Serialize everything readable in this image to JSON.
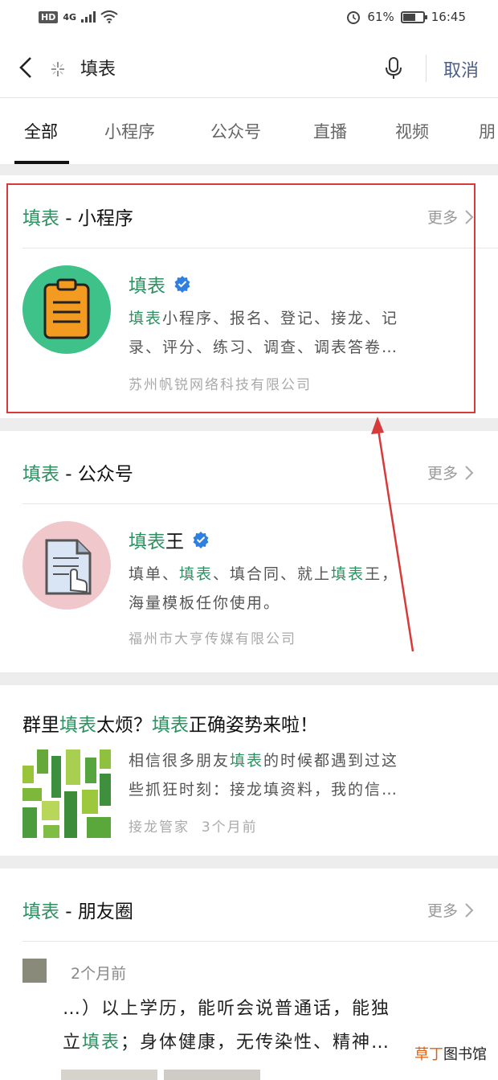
{
  "status_bar": {
    "network_label": "HD",
    "network_type": "4G",
    "battery_percent": "61%",
    "time": "16:45"
  },
  "search": {
    "query": "填表",
    "cancel_label": "取消"
  },
  "tabs": [
    {
      "label": "全部",
      "active": true
    },
    {
      "label": "小程序"
    },
    {
      "label": "公众号"
    },
    {
      "label": "直播"
    },
    {
      "label": "视频"
    },
    {
      "label": "朋"
    }
  ],
  "more_label": "更多",
  "mini_program": {
    "section_keyword": "填表",
    "section_suffix": " - 小程序",
    "name": "填表",
    "desc_line1_hl": "填表",
    "desc_line1_rest": "小程序、报名、登记、接龙、记",
    "desc_line2": "录、评分、练习、调查、调表答卷…",
    "owner": "苏州帆锐网络科技有限公司"
  },
  "official_account": {
    "section_keyword": "填表",
    "section_suffix": " - 公众号",
    "name_hl": "填表",
    "name_rest": "王",
    "desc_line1_a": "填单、",
    "desc_line1_hl1": "填表",
    "desc_line1_b": "、填合同、就上",
    "desc_line1_hl2": "填表",
    "desc_line1_c": "王，",
    "desc_line2": "海量模板任你使用。",
    "owner": "福州市大亨传媒有限公司"
  },
  "article": {
    "title_a": "群里",
    "title_hl1": "填表",
    "title_b": "太烦？",
    "title_hl2": "填表",
    "title_c": "正确姿势来啦！",
    "desc_line1_a": "相信很多朋友",
    "desc_line1_hl": "填表",
    "desc_line1_b": "的时候都遇到过这",
    "desc_line2": "些抓狂时刻：接龙填资料，我的信…",
    "source": "接龙管家",
    "time": "3个月前"
  },
  "moments": {
    "section_keyword": "填表",
    "section_suffix": " - 朋友圈",
    "time": "2个月前",
    "line1": "…）以上学历，能听会说普通话，能独",
    "line2_a": "立",
    "line2_hl": "填表",
    "line2_b": "；身体健康，无传染性、精神…"
  },
  "watermark": {
    "hl": "草丁",
    "rest": "图书馆"
  },
  "colors": {
    "highlight": "#2e9060",
    "annotation": "#d73a3a",
    "cancel": "#4a5f87",
    "verified": "#2f7fe0"
  }
}
